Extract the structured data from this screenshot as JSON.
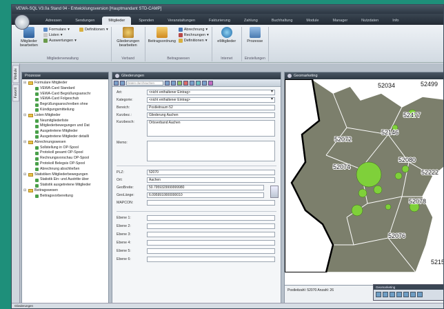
{
  "window": {
    "title": "VEWA-SQL V3.0a Stand 04 - Entwicklungsversion [Hauptmandant STD-CAMP]"
  },
  "ribbon_tabs": [
    "Adressen",
    "Sendungen",
    "Mitglieder",
    "Spenden",
    "Veranstaltungen",
    "Fakturierung",
    "Zahlung",
    "Buchhaltung",
    "Module",
    "Manager",
    "Nutzdaten",
    "Info"
  ],
  "ribbon": {
    "members_group": {
      "big_button": "Mitglieder bearbeiten",
      "small": [
        "Formulare",
        "Listen",
        "Auswertungen"
      ],
      "definitions": "Definitionen",
      "label": "Mitgliederverwaltung"
    },
    "association_group": {
      "big_button": "Gliederungen bearbeiten",
      "label": "Verband"
    },
    "contributions_group": {
      "big_button": "Beitragsordnung",
      "small": [
        "Abrechnung",
        "Rechnungen",
        "Definitionen"
      ],
      "label": "Beitragswesen"
    },
    "internet_group": {
      "big_button": "eMitglieder",
      "label": "Internet"
    },
    "settings_group": {
      "big_button": "Prozesse",
      "label": "Einstellungen"
    }
  },
  "side_tabs": [
    "Module",
    "Favorit"
  ],
  "process_panel": {
    "title": "Prozesse",
    "tree": [
      {
        "level": 0,
        "type": "folder",
        "label": "Formulare Mitglieder"
      },
      {
        "level": 1,
        "type": "leaf",
        "label": "VEWA-Card Standard"
      },
      {
        "level": 1,
        "type": "leaf",
        "label": "VEWA-Card Begrüßungsanschr"
      },
      {
        "level": 1,
        "type": "leaf",
        "label": "VEWA-Card Folgeschub"
      },
      {
        "level": 1,
        "type": "leaf",
        "label": "Begrüßungsanschreiben ohne"
      },
      {
        "level": 1,
        "type": "leaf",
        "label": "Kündigungsmitteilung"
      },
      {
        "level": 0,
        "type": "folder",
        "label": "Listen Mitglieder"
      },
      {
        "level": 1,
        "type": "leaf",
        "label": "Neumitgliederliste"
      },
      {
        "level": 1,
        "type": "leaf",
        "label": "Mitgliederbewegungen und Dat"
      },
      {
        "level": 1,
        "type": "leaf",
        "label": "Ausgetretene Mitglieder"
      },
      {
        "level": 1,
        "type": "leaf",
        "label": "Ausgetretene Mitglieder detailli"
      },
      {
        "level": 0,
        "type": "folder",
        "label": "Abrechnungswesen"
      },
      {
        "level": 1,
        "type": "leaf",
        "label": "Sollstellung in OP-Spool"
      },
      {
        "level": 1,
        "type": "leaf",
        "label": "Protokoll gesamt OP-Spool"
      },
      {
        "level": 1,
        "type": "leaf",
        "label": "Rechnungsvorschau OP-Spool"
      },
      {
        "level": 1,
        "type": "leaf",
        "label": "Protokoll Belegsis OP-Spool"
      },
      {
        "level": 1,
        "type": "leaf",
        "label": "Abrechnung abschließen"
      },
      {
        "level": 0,
        "type": "folder",
        "label": "Statistiken Mitgliederbewegungen"
      },
      {
        "level": 1,
        "type": "leaf",
        "label": "Statistik Ein- und Austritte über"
      },
      {
        "level": 1,
        "type": "leaf",
        "label": "Statistik ausgetretene Mitglieder"
      },
      {
        "level": 0,
        "type": "folder",
        "label": "Beitragswesen"
      },
      {
        "level": 1,
        "type": "leaf",
        "label": "Beitragsvorbereitung"
      }
    ]
  },
  "gliederungen_panel": {
    "title": "Gliederungen",
    "search_placeholder": "Daten durchsuchen",
    "fields": {
      "art": {
        "label": "Art:",
        "value": "<nicht enthaltener Eintrag>"
      },
      "kategorie": {
        "label": "Kategorie:",
        "value": "<nicht enthaltener Eintrag>"
      },
      "bereich": {
        "label": "Bereich:",
        "value": "Postleitraum 52"
      },
      "kurzbez": {
        "label": "Kurzbez.:",
        "value": "Gliederung Aachen"
      },
      "kurzbesch": {
        "label": "Kurzbesch:",
        "value": "Ortsverband Aachen"
      },
      "memo": {
        "label": "Memo:",
        "value": ""
      },
      "plz": {
        "label": "PLZ:",
        "value": "52070"
      },
      "ort": {
        "label": "Ort:",
        "value": "Aachen"
      },
      "geobreite": {
        "label": "GeoBreite:",
        "value": "50.7959329999999980"
      },
      "geolaenge": {
        "label": "GeoLänge:",
        "value": "6.0959910000000010"
      },
      "mapcon": {
        "label": "MAPCON:",
        "value": ""
      },
      "ebenen": [
        "Ebene 1:",
        "Ebene 2:",
        "Ebene 3:",
        "Ebene 4:",
        "Ebene 5:",
        "Ebene 6:"
      ]
    }
  },
  "geomarketing_panel": {
    "title": "Geomarketing",
    "map_labels": [
      "52034",
      "52499",
      "52477",
      "52146",
      "52072",
      "52074",
      "52080",
      "52222",
      "52078",
      "52076",
      "52159"
    ],
    "footer_text": "Postleitzahl: 52070 Anzahl: 26",
    "mini_panel_title": "Geomarketing"
  },
  "colors": {
    "region_fill": "#7c7f6c",
    "bubble_fill": "#7fd03a",
    "header": "#2e3843"
  },
  "status_bar": {
    "left_text": "Gliederungen"
  }
}
